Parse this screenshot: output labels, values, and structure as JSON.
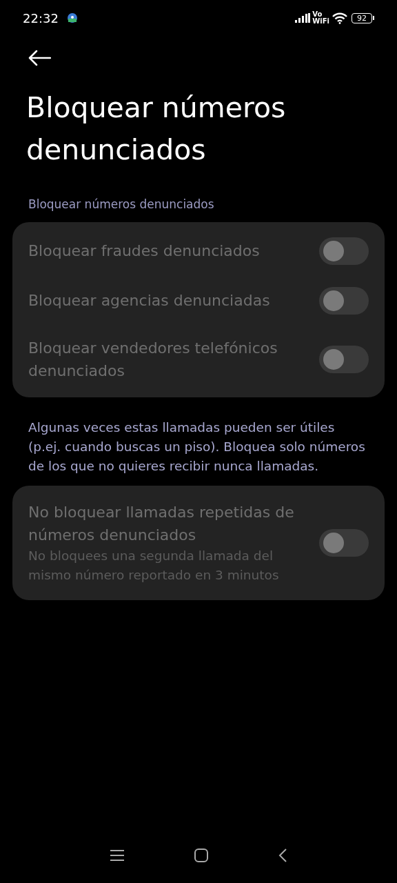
{
  "status_bar": {
    "time": "22:32",
    "network_label_top": "Vo",
    "network_label_bottom": "WiFi",
    "battery": "92"
  },
  "title": "Bloquear números denunciados",
  "section_header": "Bloquear números denunciados",
  "group_1": [
    {
      "label": "Bloquear fraudes denunciados",
      "on": false,
      "disabled": true
    },
    {
      "label": "Bloquear agencias denunciadas",
      "on": false,
      "disabled": true
    },
    {
      "label": "Bloquear vendedores telefónicos denunciados",
      "on": false,
      "disabled": true
    }
  ],
  "note": "Algunas veces estas llamadas pueden ser útiles (p.ej. cuando buscas un piso). Bloquea solo números de los que no quieres recibir nunca llamadas.",
  "group_2": [
    {
      "label": "No bloquear llamadas repetidas de números denunciados",
      "description": "No bloquees una segunda llamada del mismo número reportado en 3 minutos",
      "on": false,
      "disabled": true
    }
  ]
}
